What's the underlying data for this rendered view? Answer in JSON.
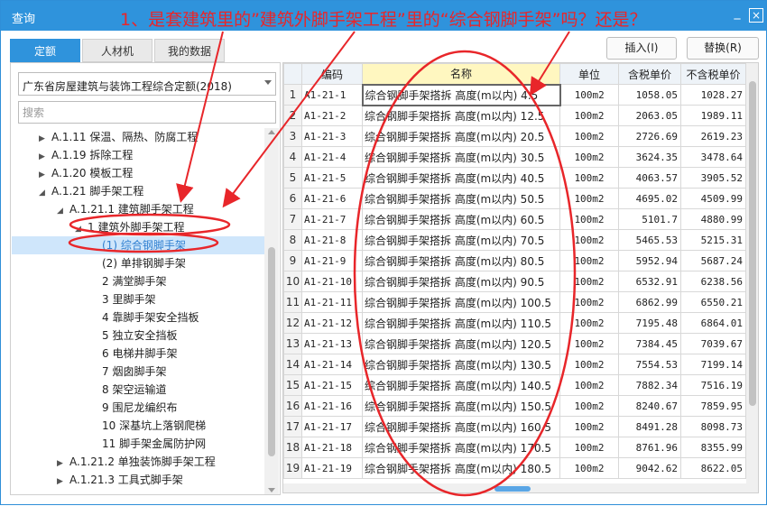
{
  "window": {
    "title": "查询"
  },
  "annotation": {
    "text": "1、是套建筑里的”建筑外脚手架工程”里的“综合钢脚手架”吗？还是？"
  },
  "titlebar_icons": {
    "minimize": "minimize-icon",
    "close": "close-icon"
  },
  "tabs": [
    {
      "label": "定额"
    },
    {
      "label": "人材机"
    },
    {
      "label": "我的数据"
    }
  ],
  "actions": {
    "insert": "插入(I)",
    "replace": "替换(R)"
  },
  "left": {
    "library": "广东省房屋建筑与装饰工程综合定额(2018)",
    "search_placeholder": "搜索",
    "tree": [
      {
        "toggle": "▶",
        "label": "A.1.11 保温、隔热、防腐工程"
      },
      {
        "toggle": "▶",
        "label": "A.1.19 拆除工程"
      },
      {
        "toggle": "▶",
        "label": "A.1.20 模板工程"
      },
      {
        "toggle": "◢",
        "label": "A.1.21 脚手架工程"
      },
      {
        "toggle": "◢",
        "label": "A.1.21.1 建筑脚手架工程"
      },
      {
        "toggle": "◢",
        "label": "1 建筑外脚手架工程"
      },
      {
        "toggle": "",
        "label": "(1) 综合钢脚手架"
      },
      {
        "toggle": "",
        "label": "(2) 单排钢脚手架"
      },
      {
        "toggle": "",
        "label": "2 满堂脚手架"
      },
      {
        "toggle": "",
        "label": "3 里脚手架"
      },
      {
        "toggle": "",
        "label": "4 靠脚手架安全挡板"
      },
      {
        "toggle": "",
        "label": "5 独立安全挡板"
      },
      {
        "toggle": "",
        "label": "6 电梯井脚手架"
      },
      {
        "toggle": "",
        "label": "7 烟囱脚手架"
      },
      {
        "toggle": "",
        "label": "8 架空运输道"
      },
      {
        "toggle": "",
        "label": "9 围尼龙编织布"
      },
      {
        "toggle": "",
        "label": "10 深基坑上落钢爬梯"
      },
      {
        "toggle": "",
        "label": "11 脚手架金属防护网"
      },
      {
        "toggle": "▶",
        "label": "A.1.21.2 单独装饰脚手架工程"
      },
      {
        "toggle": "▶",
        "label": "A.1.21.3 工具式脚手架"
      }
    ]
  },
  "grid": {
    "headers": [
      "",
      "编码",
      "名称",
      "单位",
      "含税单价",
      "不含税单价"
    ],
    "rows": [
      {
        "n": "1",
        "code": "A1-21-1",
        "name": "综合钢脚手架搭拆 高度(m以内) 4.5",
        "unit": "100m2",
        "tax": "1058.05",
        "notax": "1028.27"
      },
      {
        "n": "2",
        "code": "A1-21-2",
        "name": "综合钢脚手架搭拆 高度(m以内) 12.5",
        "unit": "100m2",
        "tax": "2063.05",
        "notax": "1989.11"
      },
      {
        "n": "3",
        "code": "A1-21-3",
        "name": "综合钢脚手架搭拆 高度(m以内) 20.5",
        "unit": "100m2",
        "tax": "2726.69",
        "notax": "2619.23"
      },
      {
        "n": "4",
        "code": "A1-21-4",
        "name": "综合钢脚手架搭拆 高度(m以内) 30.5",
        "unit": "100m2",
        "tax": "3624.35",
        "notax": "3478.64"
      },
      {
        "n": "5",
        "code": "A1-21-5",
        "name": "综合钢脚手架搭拆 高度(m以内) 40.5",
        "unit": "100m2",
        "tax": "4063.57",
        "notax": "3905.52"
      },
      {
        "n": "6",
        "code": "A1-21-6",
        "name": "综合钢脚手架搭拆 高度(m以内) 50.5",
        "unit": "100m2",
        "tax": "4695.02",
        "notax": "4509.99"
      },
      {
        "n": "7",
        "code": "A1-21-7",
        "name": "综合钢脚手架搭拆 高度(m以内) 60.5",
        "unit": "100m2",
        "tax": "5101.7",
        "notax": "4880.99"
      },
      {
        "n": "8",
        "code": "A1-21-8",
        "name": "综合钢脚手架搭拆 高度(m以内) 70.5",
        "unit": "100m2",
        "tax": "5465.53",
        "notax": "5215.31"
      },
      {
        "n": "9",
        "code": "A1-21-9",
        "name": "综合钢脚手架搭拆 高度(m以内) 80.5",
        "unit": "100m2",
        "tax": "5952.94",
        "notax": "5687.24"
      },
      {
        "n": "10",
        "code": "A1-21-10",
        "name": "综合钢脚手架搭拆 高度(m以内) 90.5",
        "unit": "100m2",
        "tax": "6532.91",
        "notax": "6238.56"
      },
      {
        "n": "11",
        "code": "A1-21-11",
        "name": "综合钢脚手架搭拆 高度(m以内) 100.5",
        "unit": "100m2",
        "tax": "6862.99",
        "notax": "6550.21"
      },
      {
        "n": "12",
        "code": "A1-21-12",
        "name": "综合钢脚手架搭拆 高度(m以内) 110.5",
        "unit": "100m2",
        "tax": "7195.48",
        "notax": "6864.01"
      },
      {
        "n": "13",
        "code": "A1-21-13",
        "name": "综合钢脚手架搭拆 高度(m以内) 120.5",
        "unit": "100m2",
        "tax": "7384.45",
        "notax": "7039.67"
      },
      {
        "n": "14",
        "code": "A1-21-14",
        "name": "综合钢脚手架搭拆 高度(m以内) 130.5",
        "unit": "100m2",
        "tax": "7554.53",
        "notax": "7199.14"
      },
      {
        "n": "15",
        "code": "A1-21-15",
        "name": "综合钢脚手架搭拆 高度(m以内) 140.5",
        "unit": "100m2",
        "tax": "7882.34",
        "notax": "7516.19"
      },
      {
        "n": "16",
        "code": "A1-21-16",
        "name": "综合钢脚手架搭拆 高度(m以内) 150.5",
        "unit": "100m2",
        "tax": "8240.67",
        "notax": "7859.95"
      },
      {
        "n": "17",
        "code": "A1-21-17",
        "name": "综合钢脚手架搭拆 高度(m以内) 160.5",
        "unit": "100m2",
        "tax": "8491.28",
        "notax": "8098.73"
      },
      {
        "n": "18",
        "code": "A1-21-18",
        "name": "综合钢脚手架搭拆 高度(m以内) 170.5",
        "unit": "100m2",
        "tax": "8761.96",
        "notax": "8355.99"
      },
      {
        "n": "19",
        "code": "A1-21-19",
        "name": "综合钢脚手架搭拆 高度(m以内) 180.5",
        "unit": "100m2",
        "tax": "9042.62",
        "notax": "8622.05"
      }
    ]
  },
  "colors": {
    "titlebar": "#2f93dc",
    "annotation": "#e8262a",
    "selected_row": "#cfe6fb"
  }
}
